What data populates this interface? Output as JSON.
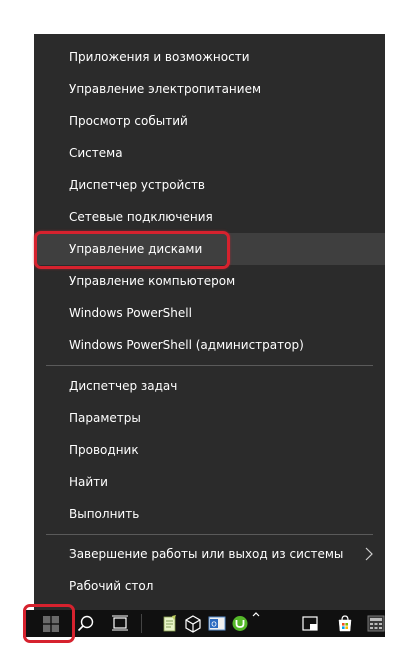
{
  "menu": {
    "items": [
      {
        "label": "Приложения и возможности"
      },
      {
        "label": "Управление электропитанием"
      },
      {
        "label": "Просмотр событий"
      },
      {
        "label": "Система"
      },
      {
        "label": "Диспетчер устройств"
      },
      {
        "label": "Сетевые подключения"
      },
      {
        "label": "Управление дисками",
        "hovered": true
      },
      {
        "label": "Управление компьютером"
      },
      {
        "label": "Windows PowerShell"
      },
      {
        "label": "Windows PowerShell (администратор)"
      },
      {
        "label": "Диспетчер задач"
      },
      {
        "label": "Параметры"
      },
      {
        "label": "Проводник"
      },
      {
        "label": "Найти"
      },
      {
        "label": "Выполнить"
      },
      {
        "label": "Завершение работы или выход из системы",
        "has_submenu": true
      },
      {
        "label": "Рабочий стол"
      }
    ]
  },
  "taskbar": {
    "icons": [
      "windows-start-icon",
      "search-icon",
      "task-view-icon",
      "notepad-icon",
      "box-3d-icon",
      "outlook-icon",
      "utorrent-icon",
      "overflow-icon",
      "app-icon",
      "store-icon",
      "calculator-icon"
    ]
  },
  "colors": {
    "menu_bg": "#2b2b2b",
    "hover_bg": "#3f3f3f",
    "highlight": "#d6222e",
    "text": "#ffffff",
    "taskbar_bg": "#101010"
  }
}
